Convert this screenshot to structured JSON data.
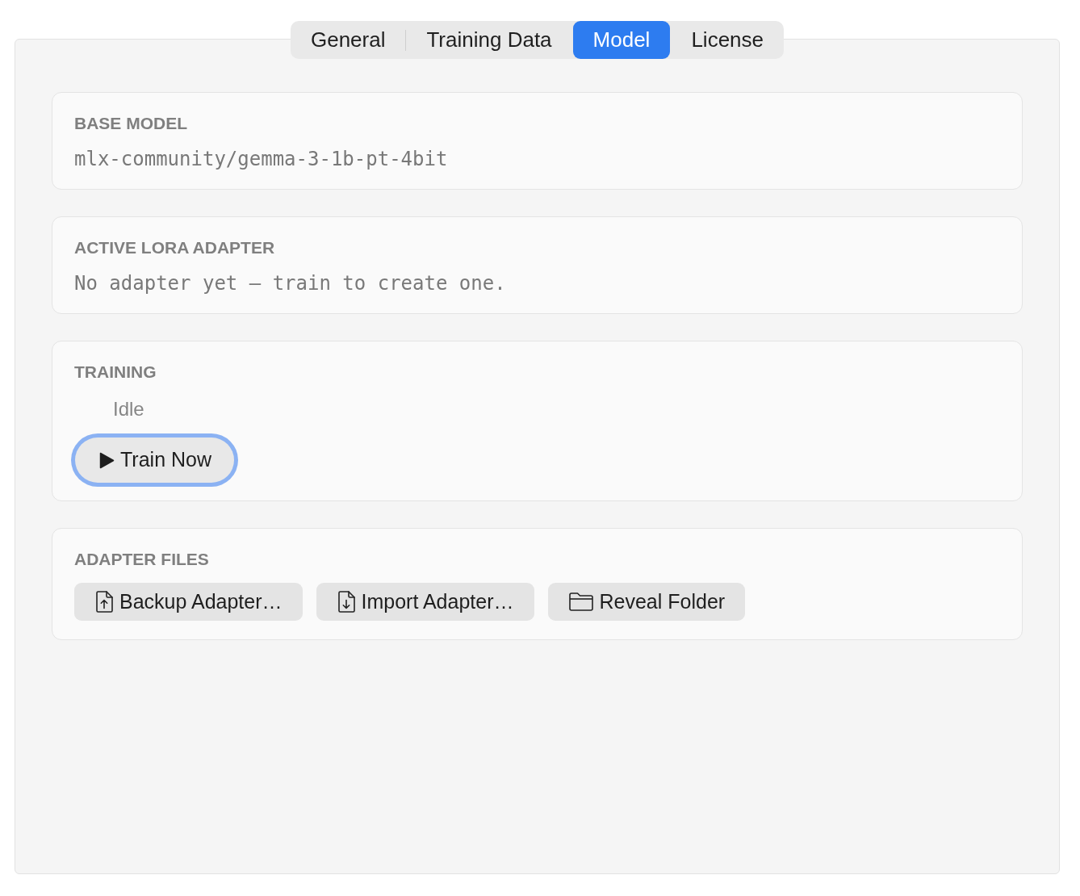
{
  "tabs": [
    {
      "label": "General",
      "selected": false
    },
    {
      "label": "Training Data",
      "selected": false
    },
    {
      "label": "Model",
      "selected": true
    },
    {
      "label": "License",
      "selected": false
    }
  ],
  "sections": [
    {
      "kind": "text",
      "title": "BASE MODEL",
      "value": "mlx-community/gemma-3-1b-pt-4bit"
    },
    {
      "kind": "text",
      "title": "ACTIVE LORA ADAPTER",
      "value": "No adapter yet — train to create one."
    },
    {
      "kind": "training",
      "title": "TRAINING",
      "status": "Idle",
      "button": {
        "label": "Train Now",
        "focused": true
      }
    },
    {
      "kind": "buttons",
      "title": "ADAPTER FILES",
      "buttons": [
        {
          "label": "Backup Adapter…"
        },
        {
          "label": "Import Adapter…"
        },
        {
          "label": "Reveal Folder"
        }
      ]
    }
  ]
}
